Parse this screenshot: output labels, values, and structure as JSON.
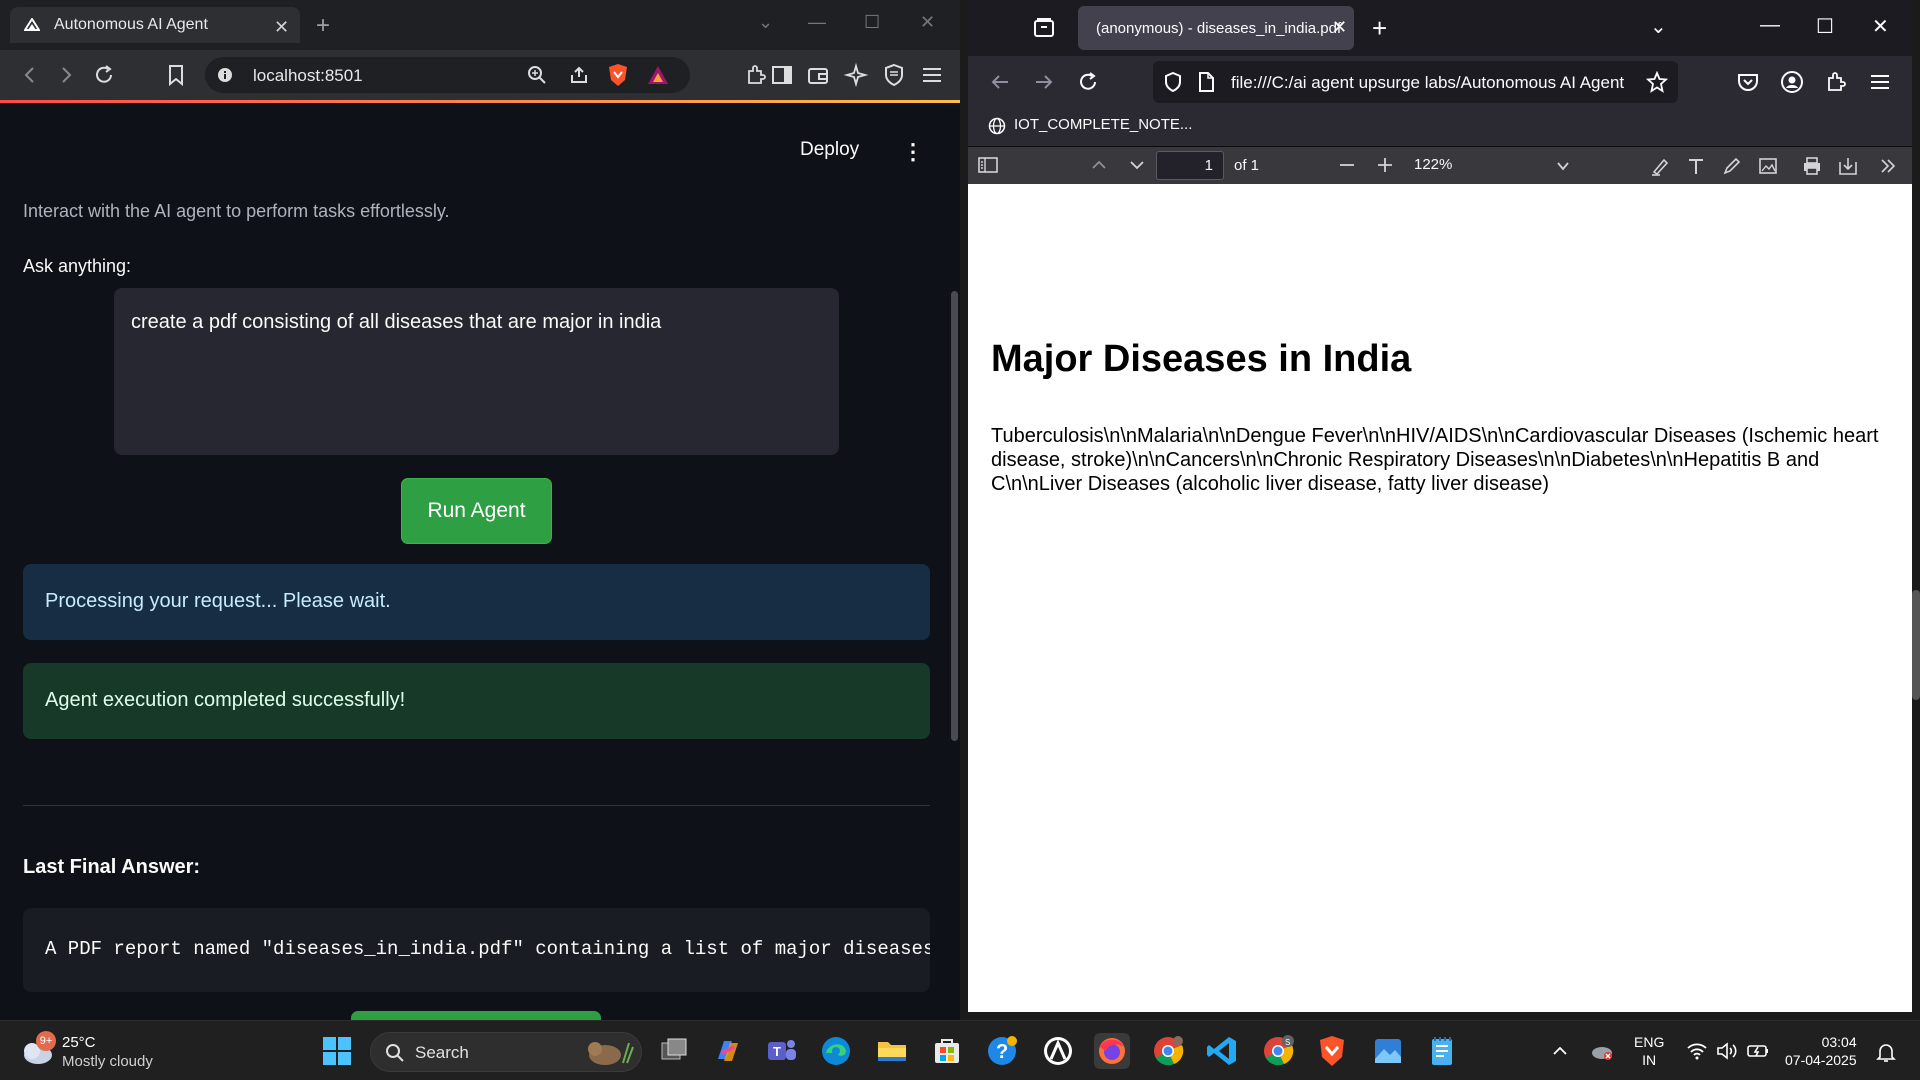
{
  "left_browser": {
    "tab_title": "Autonomous AI Agent",
    "url": "localhost:8501",
    "app": {
      "deploy_label": "Deploy",
      "subtitle": "Interact with the AI agent to perform tasks effortlessly.",
      "ask_label": "Ask anything:",
      "query_value": "create a pdf consisting of all diseases that are major in india",
      "run_button": "Run Agent",
      "info_message": "Processing your request... Please wait.",
      "success_message": "Agent execution completed successfully!",
      "answer_heading": "Last Final Answer:",
      "answer_text": "A PDF report named \"diseases_in_india.pdf\" containing a list of major diseases in India"
    }
  },
  "right_browser": {
    "tab_title": "(anonymous) - diseases_in_india.pdf",
    "url": "file:///C:/ai agent upsurge labs/Autonomous AI Agent",
    "bookmark": "IOT_COMPLETE_NOTE...",
    "pdf_toolbar": {
      "page_number": "1",
      "page_of": "of 1",
      "zoom": "122%"
    },
    "pdf": {
      "title": "Major Diseases in India",
      "body": "Tuberculosis\\n\\nMalaria\\n\\nDengue Fever\\n\\nHIV/AIDS\\n\\nCardiovascular Diseases (Ischemic heart disease, stroke)\\n\\nCancers\\n\\nChronic Respiratory Diseases\\n\\nDiabetes\\n\\nHepatitis B and C\\n\\nLiver Diseases (alcoholic liver disease, fatty liver disease)"
    }
  },
  "taskbar": {
    "weather_temp": "25°C",
    "weather_condition": "Mostly cloudy",
    "weather_badge": "9+",
    "search_label": "Search",
    "lang_top": "ENG",
    "lang_bottom": "IN",
    "time": "03:04",
    "date": "07-04-2025"
  },
  "colors": {
    "streamlit_bg": "#0e1117",
    "run_button": "#2ea043",
    "info_bg": "#172d43",
    "success_bg": "#173928",
    "firefox_chrome": "#2b2a33"
  }
}
